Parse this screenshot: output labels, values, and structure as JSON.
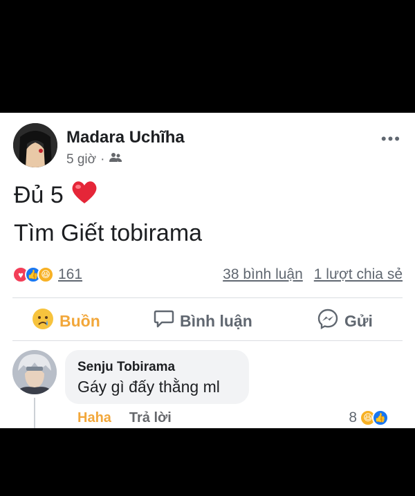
{
  "post": {
    "author": "Madara Uchĩha",
    "time": "5 giờ",
    "separator": "·",
    "audience_icon": "friends-icon",
    "more_icon": "•••",
    "text_line1": "Đủ 5",
    "text_line2": "Tìm Giết  tobirama",
    "reaction_count": "161",
    "comments_count": "38 bình luận",
    "shares_count": "1 lượt chia sẻ"
  },
  "actions": {
    "sad": "Buồn",
    "comment": "Bình luận",
    "send": "Gửi"
  },
  "comment": {
    "name": "Senju Tobirama",
    "text": "Gáy gì đấy thằng ml",
    "haha_label": "Haha",
    "reply_label": "Trả lời",
    "reaction_count": "8"
  },
  "colors": {
    "love": "#f33e58",
    "like": "#1877f2",
    "haha": "#f7b125",
    "sad_label": "#f2a73a",
    "text": "#1c1e21",
    "muted": "#606770"
  }
}
